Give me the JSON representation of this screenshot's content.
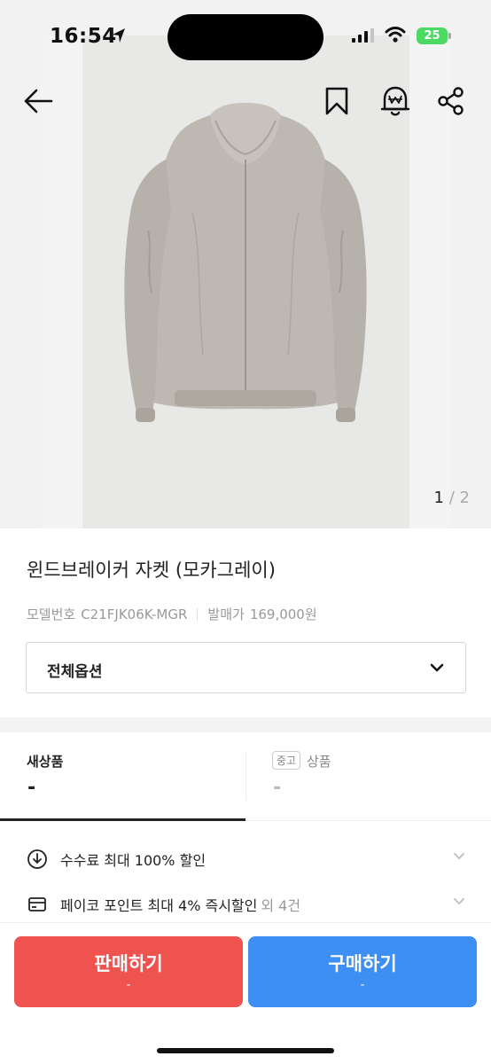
{
  "status_bar": {
    "time": "16:54",
    "battery": "25"
  },
  "nav": {
    "back_icon": "arrow-left-icon",
    "bookmark_icon": "bookmark-icon",
    "alarm_icon": "price-alert-bell-icon",
    "share_icon": "share-icon"
  },
  "gallery": {
    "current": "1",
    "separator": "/",
    "total": "2"
  },
  "product": {
    "title": "윈드브레이커 자켓 (모카그레이)",
    "model_label": "모델번호",
    "model_number": "C21FJK06K-MGR",
    "release_price_label": "발매가",
    "release_price": "169,000원"
  },
  "option_select": {
    "selected": "전체옵션"
  },
  "condition_tabs": {
    "new": {
      "label": "새상품",
      "price": "-"
    },
    "used": {
      "badge": "중고",
      "label": "상품",
      "price": "-"
    }
  },
  "benefits": [
    {
      "icon": "discount-coin-icon",
      "text": "수수료 최대 100% 할인",
      "extra": ""
    },
    {
      "icon": "card-icon",
      "text": "페이코 포인트 최대 4% 즉시할인",
      "extra": "외 4건"
    }
  ],
  "actions": {
    "sell": {
      "label": "판매하기",
      "sub": "-"
    },
    "buy": {
      "label": "구매하기",
      "sub": "-"
    }
  },
  "colors": {
    "sell": "#ef5350",
    "buy": "#3d8ff3",
    "battery": "#4cd964"
  }
}
